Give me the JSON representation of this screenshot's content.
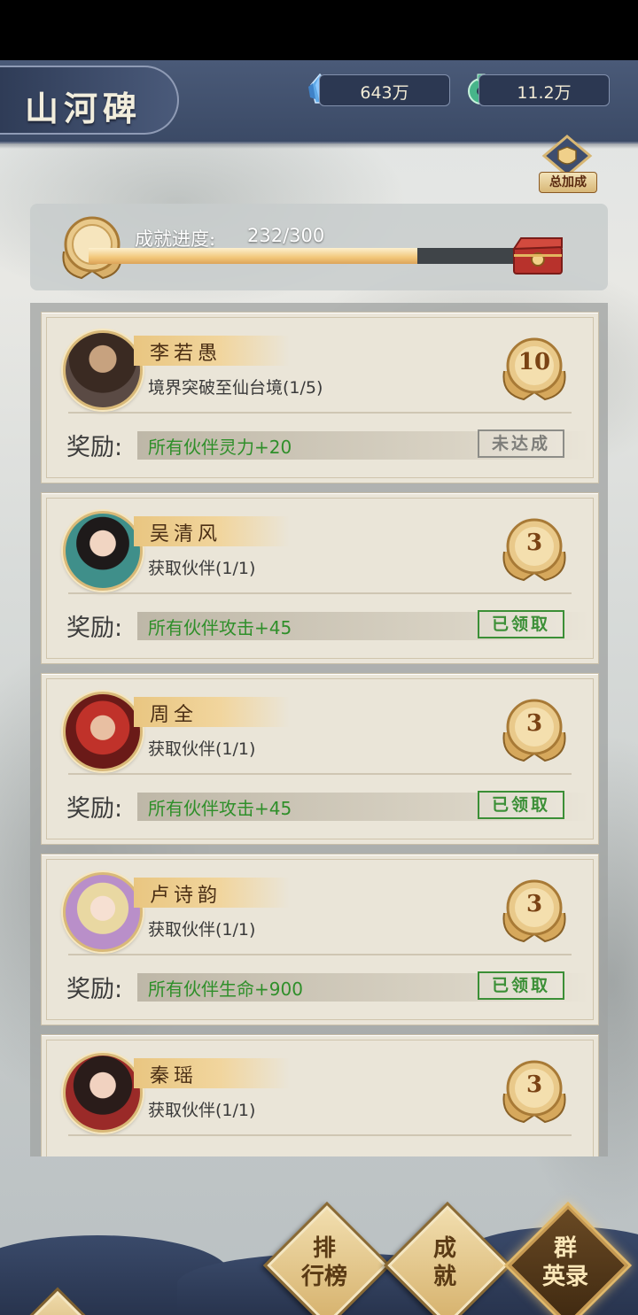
{
  "header": {
    "title": "山河碑",
    "currency": [
      {
        "icon": "blue-crystal-icon",
        "value": "643万"
      },
      {
        "icon": "jade-coin-icon",
        "value": "11.2万"
      }
    ],
    "bonus_button_label": "总加成"
  },
  "progress": {
    "label": "成就进度:",
    "value_text": "232/300",
    "current": 232,
    "total": 300
  },
  "cards": [
    {
      "name": "李若愚",
      "task": "境界突破至仙台境(1/5)",
      "reward_label": "奖励:",
      "reward": "所有伙伴灵力+20",
      "status": "未达成",
      "status_type": "todo",
      "points": "10"
    },
    {
      "name": "吴清风",
      "task": "获取伙伴(1/1)",
      "reward_label": "奖励:",
      "reward": "所有伙伴攻击+45",
      "status": "已领取",
      "status_type": "done",
      "points": "3"
    },
    {
      "name": "周全",
      "task": "获取伙伴(1/1)",
      "reward_label": "奖励:",
      "reward": "所有伙伴攻击+45",
      "status": "已领取",
      "status_type": "done",
      "points": "3"
    },
    {
      "name": "卢诗韵",
      "task": "获取伙伴(1/1)",
      "reward_label": "奖励:",
      "reward": "所有伙伴生命+900",
      "status": "已领取",
      "status_type": "done",
      "points": "3"
    },
    {
      "name": "秦瑶",
      "task": "获取伙伴(1/1)",
      "reward_label": "奖励:",
      "reward": "",
      "status": "",
      "status_type": "done",
      "points": "3"
    }
  ],
  "nav": {
    "ranking": "排行榜",
    "achievement": "成就",
    "heroes": "群英录"
  },
  "colors": {
    "header_bg": "#3b4a66",
    "reward_green": "#2f8f2a",
    "gold": "#d9b978",
    "progress_fill": "#f2c77a"
  }
}
